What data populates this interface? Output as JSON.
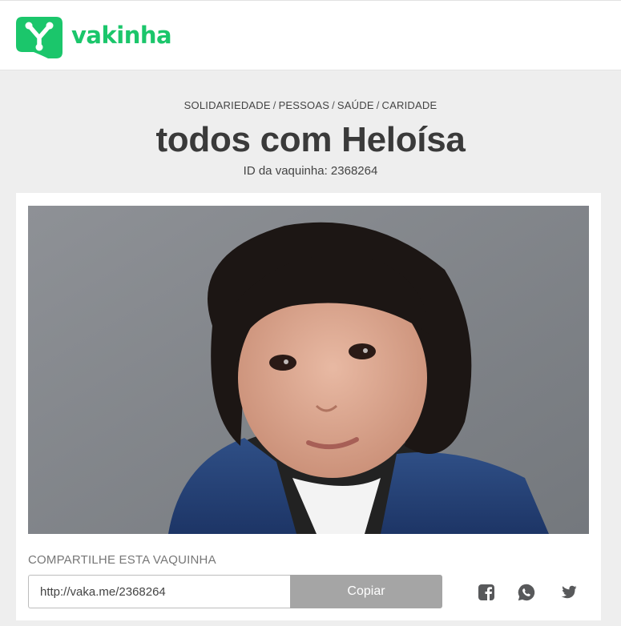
{
  "brand": {
    "name": "vakinha",
    "color": "#1bc66b"
  },
  "breadcrumb": {
    "items": [
      "SOLIDARIEDADE",
      "PESSOAS",
      "SAÚDE",
      "CARIDADE"
    ],
    "separator": "/"
  },
  "campaign": {
    "title": "todos com Heloísa",
    "id_text": "ID da vaquinha: 2368264"
  },
  "share": {
    "label": "COMPARTILHE ESTA VAQUINHA",
    "url": "http://vaka.me/2368264",
    "copy_label": "Copiar",
    "networks": [
      "facebook-icon",
      "whatsapp-icon",
      "twitter-icon"
    ]
  }
}
